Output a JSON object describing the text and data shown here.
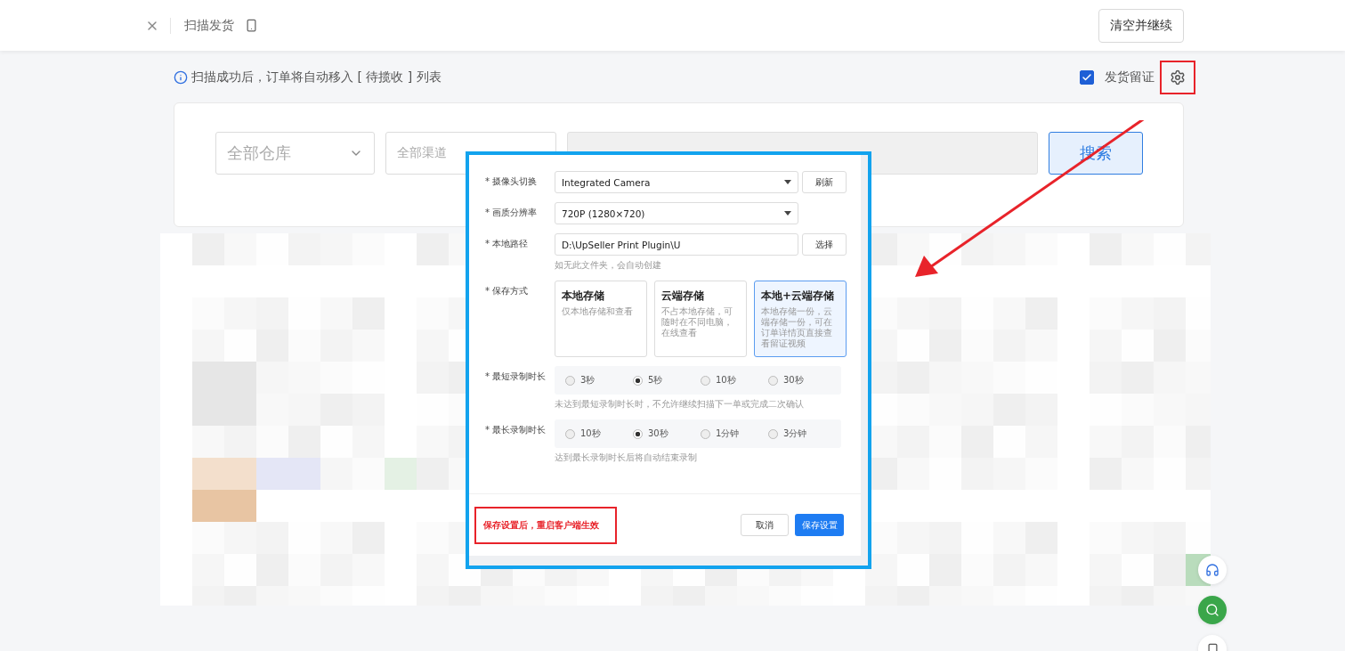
{
  "topbar": {
    "title": "扫描发货",
    "clear_button": "清空并继续"
  },
  "notice": "扫描成功后，订单将自动移入 [ 待揽收 ] 列表",
  "evidence": {
    "label": "发货留证",
    "checked": true
  },
  "filters": {
    "warehouse": "全部仓库",
    "channel": "全部渠道",
    "search_button": "搜索"
  },
  "dialog": {
    "rows": [
      {
        "kind": "select",
        "label": "* 摄像头切换",
        "value": "Integrated Camera",
        "button": "刷新"
      },
      {
        "kind": "select",
        "label": "* 画质分辨率",
        "value": "720P (1280×720)"
      },
      {
        "kind": "path",
        "label": "* 本地路径",
        "value": "D:\\UpSeller Print Plugin\\U",
        "button": "选择",
        "hint": "如无此文件夹，会自动创建"
      },
      {
        "kind": "cards",
        "label": "* 保存方式",
        "options": [
          {
            "title": "本地存储",
            "desc": "仅本地存储和查看",
            "selected": false
          },
          {
            "title": "云端存储",
            "desc": "不占本地存储，可随时在不同电脑，在线查看",
            "selected": false
          },
          {
            "title": "本地+云端存储",
            "desc": "本地存储一份，云端存储一份，可在订单详情页直接查看留证视频",
            "selected": true
          }
        ]
      },
      {
        "kind": "radio",
        "label": "* 最短录制时长",
        "options": [
          {
            "label": "3秒",
            "selected": false
          },
          {
            "label": "5秒",
            "selected": true
          },
          {
            "label": "10秒",
            "selected": false
          },
          {
            "label": "30秒",
            "selected": false
          }
        ],
        "hint": "未达到最短录制时长时，不允许继续扫描下一单或完成二次确认"
      },
      {
        "kind": "radio",
        "label": "* 最长录制时长",
        "options": [
          {
            "label": "10秒",
            "selected": false
          },
          {
            "label": "30秒",
            "selected": true
          },
          {
            "label": "1分钟",
            "selected": false
          },
          {
            "label": "3分钟",
            "selected": false
          }
        ],
        "hint": "达到最长录制时长后将自动结束录制"
      }
    ],
    "note": "保存设置后，重启客户端生效",
    "cancel": "取消",
    "save": "保存设置"
  }
}
